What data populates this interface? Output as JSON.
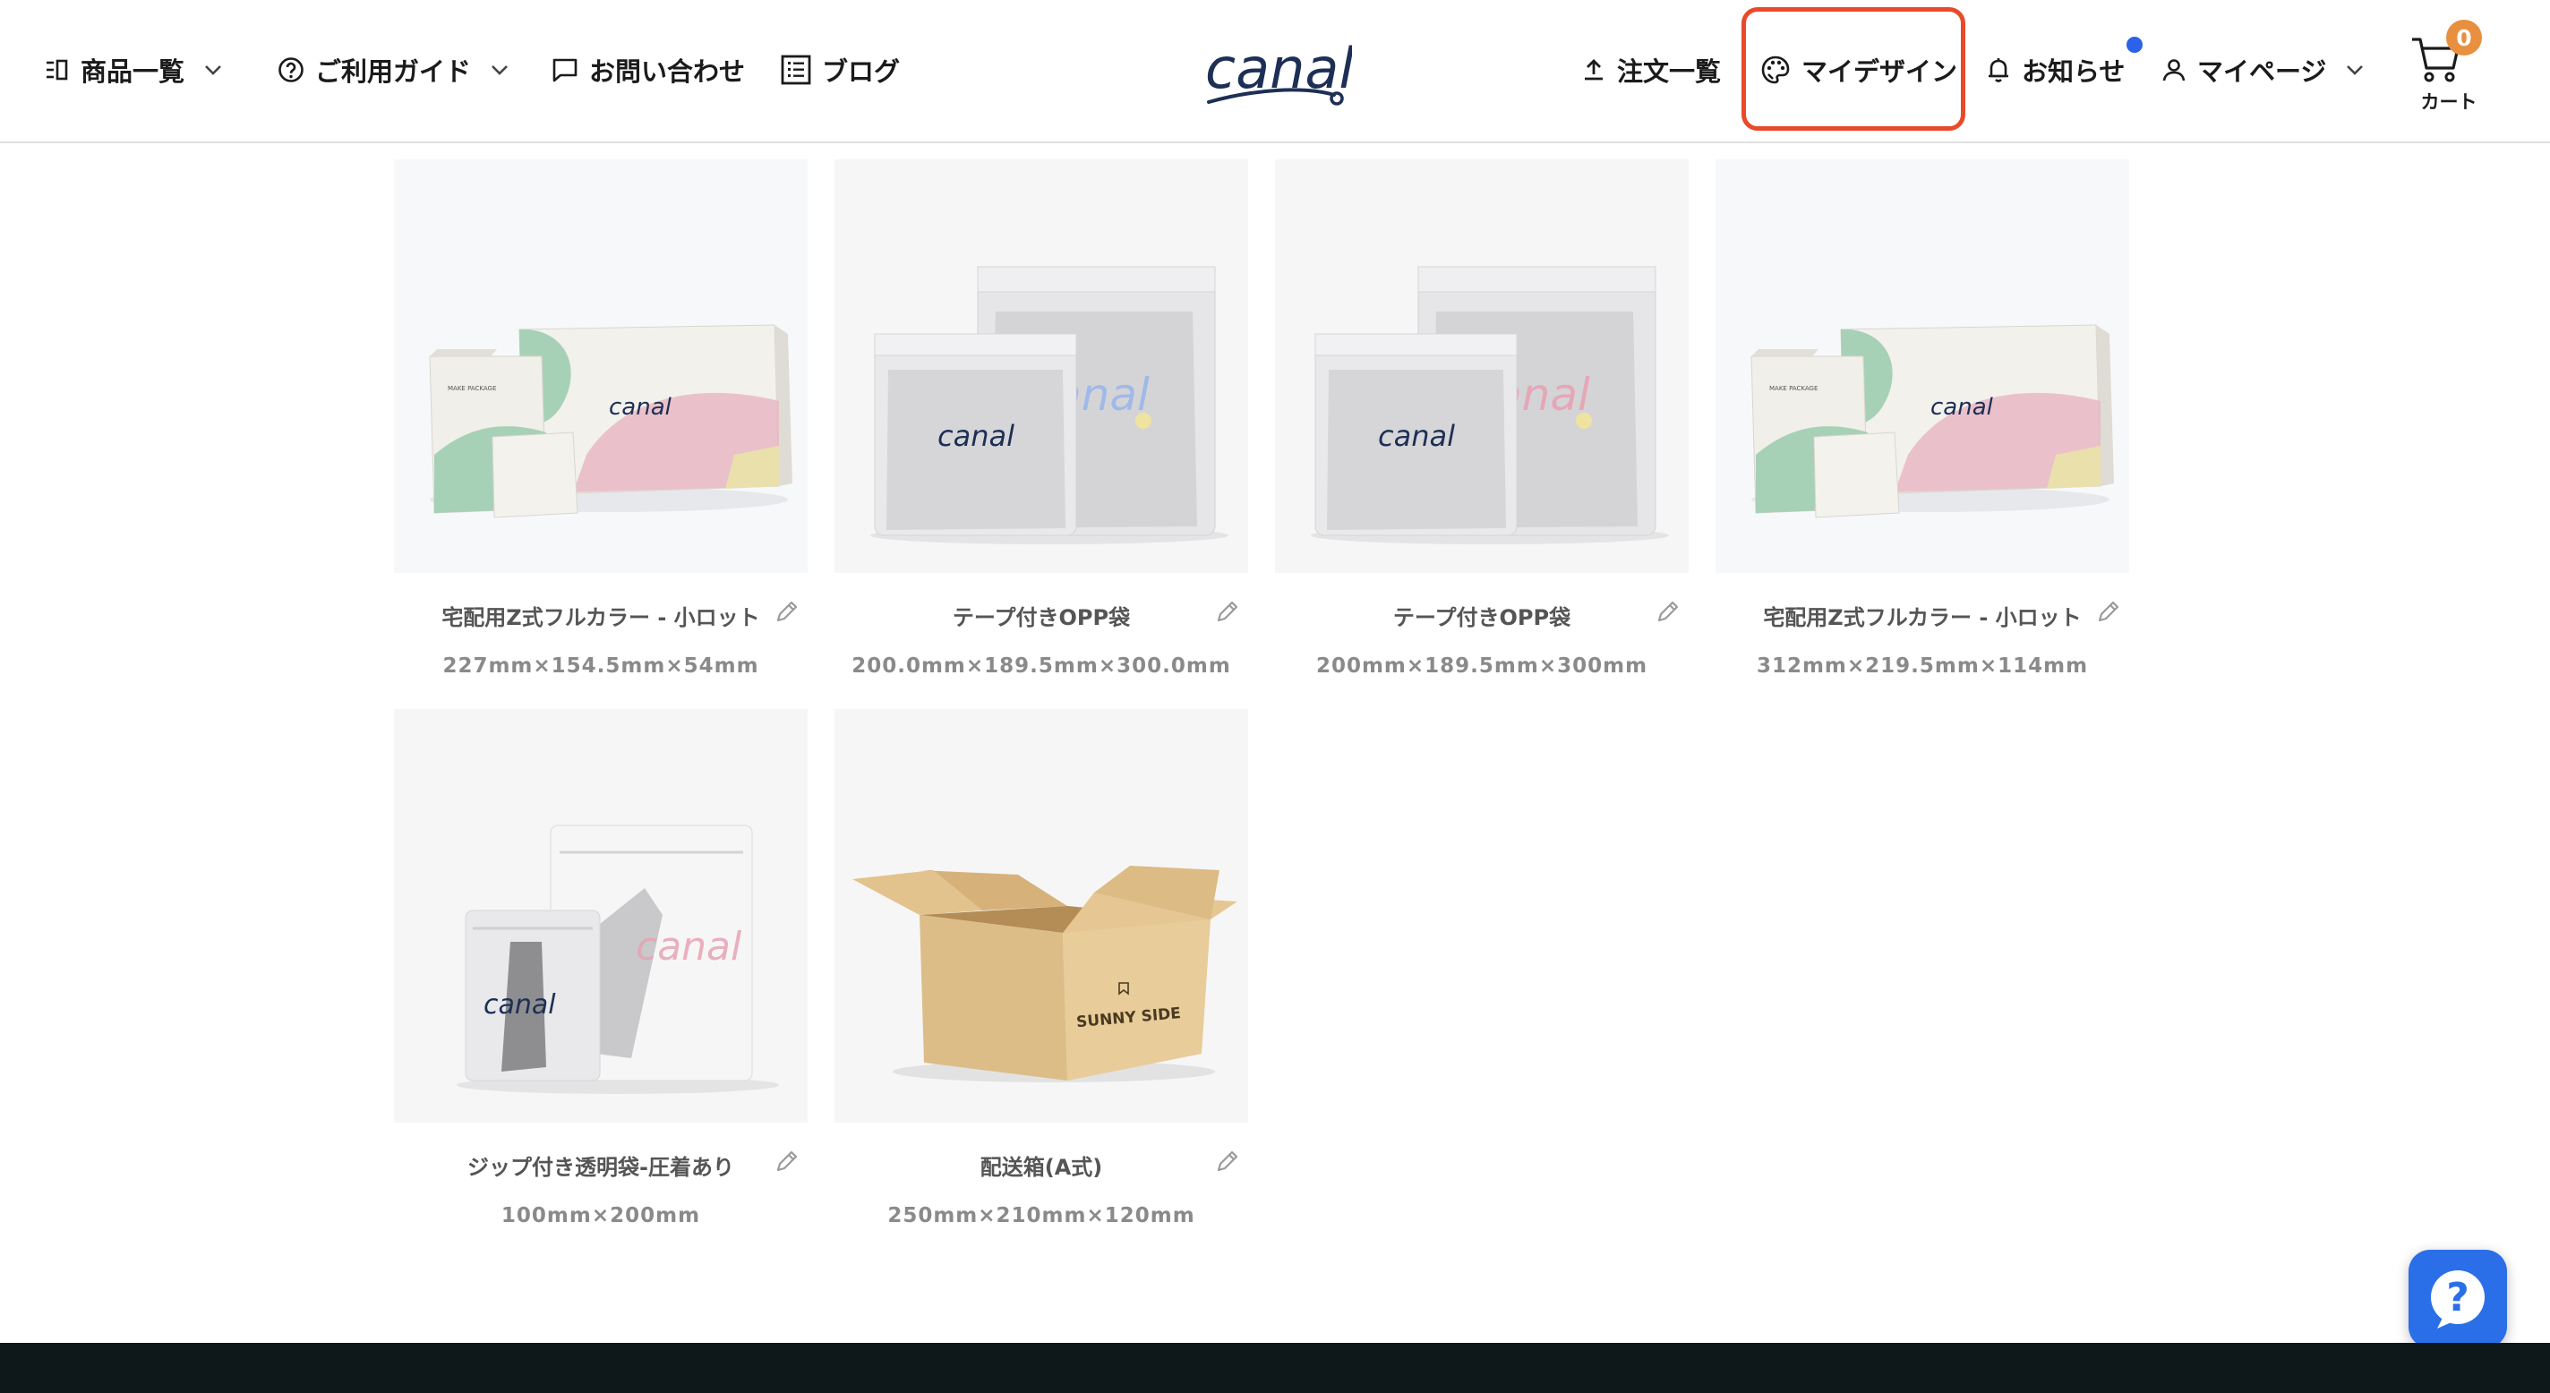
{
  "header": {
    "nav_left": [
      {
        "label": "商品一覧",
        "icon": "menu-list-icon",
        "dropdown": true
      },
      {
        "label": "ご利用ガイド",
        "icon": "question-circle-icon",
        "dropdown": true
      },
      {
        "label": "お問い合わせ",
        "icon": "chat-bubble-icon",
        "dropdown": false
      },
      {
        "label": "ブログ",
        "icon": "blog-list-icon",
        "dropdown": false
      }
    ],
    "logo_text": "canal",
    "nav_right": [
      {
        "label": "注文一覧",
        "icon": "upload-arrow-icon"
      },
      {
        "label": "マイデザイン",
        "icon": "palette-icon",
        "highlighted": true
      },
      {
        "label": "お知らせ",
        "icon": "bell-icon",
        "has_notification": true
      },
      {
        "label": "マイページ",
        "icon": "user-icon",
        "dropdown": true
      }
    ],
    "cart": {
      "count": "0",
      "label": "カート"
    }
  },
  "products": [
    {
      "name": "宅配用Z式フルカラー - 小ロット",
      "dimensions": "227mm×154.5mm×54mm",
      "image": "mailer-box"
    },
    {
      "name": "テープ付きOPP袋",
      "dimensions": "200.0mm×189.5mm×300.0mm",
      "image": "opp-bag"
    },
    {
      "name": "テープ付きOPP袋",
      "dimensions": "200mm×189.5mm×300mm",
      "image": "opp-bag"
    },
    {
      "name": "宅配用Z式フルカラー - 小ロット",
      "dimensions": "312mm×219.5mm×114mm",
      "image": "mailer-box"
    },
    {
      "name": "ジップ付き透明袋-圧着あり",
      "dimensions": "100mm×200mm",
      "image": "zip-bag"
    },
    {
      "name": "配送箱(A式)",
      "dimensions": "250mm×210mm×120mm",
      "image": "cardboard-box",
      "box_text": "SUNNY SIDE"
    }
  ],
  "help_button": {
    "icon": "question-icon",
    "glyph": "?"
  },
  "colors": {
    "highlight": "#e84a2a",
    "accent_blue": "#2b6fe8",
    "badge": "#e89040",
    "footer": "#0e1719"
  }
}
